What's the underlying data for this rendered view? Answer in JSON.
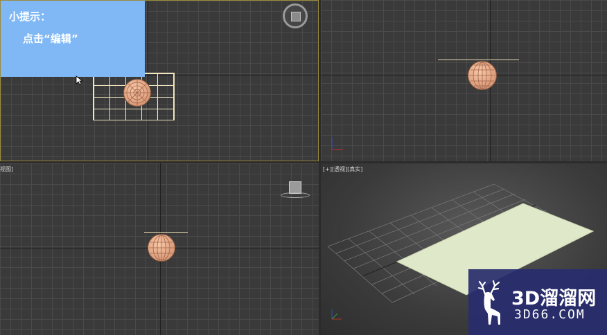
{
  "hint": {
    "title": "小提示：",
    "instruction": "点击“编辑”"
  },
  "viewports": {
    "top": {
      "label": ""
    },
    "front": {
      "label": ""
    },
    "left": {
      "label": "视图]"
    },
    "perspective": {
      "label": "[+][透视][真实]"
    }
  },
  "watermark": {
    "name": "3D溜溜网",
    "url": "3D66.COM"
  },
  "colors": {
    "hint_background": "#7fb8f5",
    "active_viewport_border": "#9a8a3c",
    "sphere": "#d99a78",
    "plane": "#dfe8c8",
    "watermark_background": "#282d6e"
  },
  "icons": [
    "viewcube-icon",
    "mouse-cursor-icon",
    "deer-logo-icon",
    "axis-gizmo-icon"
  ]
}
